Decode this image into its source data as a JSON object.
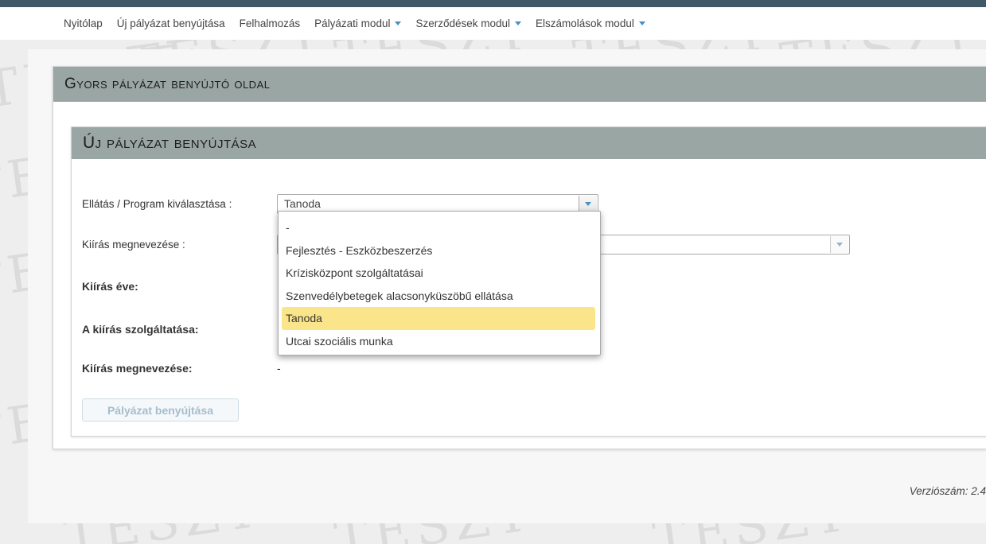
{
  "nav": {
    "items": [
      {
        "label": "Nyitólap",
        "dropdown": false
      },
      {
        "label": "Új pályázat benyújtása",
        "dropdown": false
      },
      {
        "label": "Felhalmozás",
        "dropdown": false
      },
      {
        "label": "Pályázati modul",
        "dropdown": true
      },
      {
        "label": "Szerződések modul",
        "dropdown": true
      },
      {
        "label": "Elszámolások modul",
        "dropdown": true
      }
    ]
  },
  "watermark": "TESZT",
  "page": {
    "title": "Gyors pályázat benyújtó oldal"
  },
  "form": {
    "title": "Új pályázat benyújtása",
    "program_label": "Ellátás / Program kiválasztása :",
    "program_value": "Tanoda",
    "kiiras_label": "Kiírás megnevezése :",
    "kiiras_value": "",
    "year_label": "Kiírás éve:",
    "service_label": "A kiírás szolgáltatása:",
    "name_label": "Kiírás megnevezése:",
    "name_value": "-",
    "submit_label": "Pályázat benyújtása"
  },
  "dropdown": {
    "options": [
      "-",
      "Fejlesztés - Eszközbeszerzés",
      "Krízisközpont szolgáltatásai",
      "Szenvedélybetegek alacsonyküszöbű ellátása",
      "Tanoda",
      "Utcai szociális munka"
    ],
    "selected_index": 4
  },
  "footer": {
    "version": "Verziószám: 2.4"
  },
  "colors": {
    "header_bg": "#9aa6a4",
    "topstripe": "#3f5a66",
    "highlight": "#fbe58a",
    "caret": "#4a8fc2"
  }
}
